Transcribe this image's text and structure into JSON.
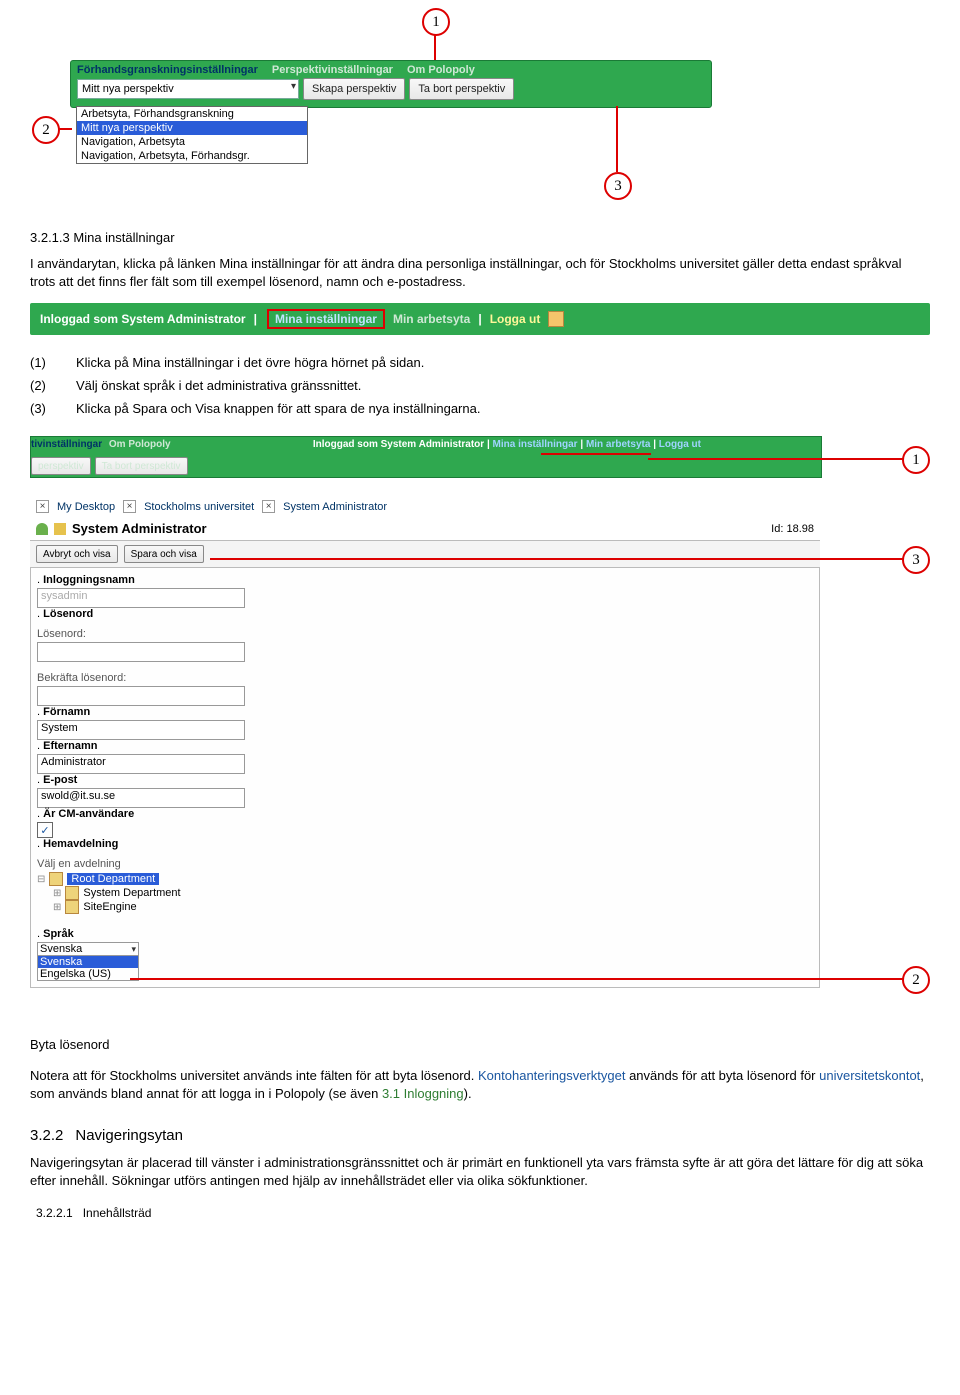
{
  "fig1": {
    "tabs": [
      "Förhandsgranskningsinställningar",
      "Perspektivinställningar",
      "Om Polopoly"
    ],
    "select_current": "Mitt nya perspektiv",
    "btn_create": "Skapa perspektiv",
    "btn_delete": "Ta bort perspektiv",
    "options": [
      "Arbetsyta, Förhandsgranskning",
      "Mitt nya perspektiv",
      "Navigation, Arbetsyta",
      "Navigation, Arbetsyta, Förhandsgr."
    ],
    "callouts": {
      "c1": "1",
      "c2": "2",
      "c3": "3"
    }
  },
  "section1": {
    "num_title": "3.2.1.3 Mina inställningar",
    "para": "I användarytan, klicka på länken Mina inställningar för att ändra dina personliga inställningar, och för Stockholms universitet gäller detta endast språkval trots att det finns fler fält som till exempel lösenord, namn och e-postadress."
  },
  "greenbar": {
    "label": "Inloggad som System Administrator",
    "mina": "Mina inställningar",
    "work": "Min arbetsyta",
    "logout": "Logga ut"
  },
  "numlist": {
    "i1": "Klicka på Mina inställningar i det övre högra hörnet på sidan.",
    "i2": "Välj önskat språk i det administrativa gränssnittet.",
    "i3": "Klicka på Spara och Visa knappen för att spara de nya inställningarna.",
    "n1": "(1)",
    "n2": "(2)",
    "n3": "(3)"
  },
  "fig2": {
    "top_left1": "tivinställningar",
    "top_left2": "Om Polopoly",
    "top_btn1": "perspektiv",
    "top_btn2": "Ta bort perspektiv",
    "top_right_logged": "Inloggad som System Administrator",
    "top_right_mina": "Mina inställningar",
    "top_right_work": "Min arbetsyta",
    "top_right_logout": "Logga ut",
    "crumb1": "My Desktop",
    "crumb2": "Stockholms universitet",
    "crumb3": "System Administrator",
    "title": "System Administrator",
    "id": "Id: 18.98",
    "btn_cancel": "Avbryt och visa",
    "btn_save": "Spara och visa",
    "lbl_login": "Inloggningsnamn",
    "val_login": "sysadmin",
    "lbl_pwd": "Lösenord",
    "lbl_pwd2": "Lösenord:",
    "lbl_confirm": "Bekräfta lösenord:",
    "lbl_first": "Förnamn",
    "val_first": "System",
    "lbl_last": "Efternamn",
    "val_last": "Administrator",
    "lbl_email": "E-post",
    "val_email": "swold@it.su.se",
    "lbl_cm": "Är CM-användare",
    "lbl_dept": "Hemavdelning",
    "lbl_choose": "Välj en avdelning",
    "tree_root": "Root Department",
    "tree_child1": "System Department",
    "tree_child2": "SiteEngine",
    "lbl_lang": "Språk",
    "lang_current": "Svenska",
    "lang_opt1": "Svenska",
    "lang_opt2": "Engelska (US)",
    "callouts": {
      "c1": "1",
      "c2": "2",
      "c3": "3"
    }
  },
  "section2": {
    "byta": "Byta lösenord",
    "p1a": "Notera att för Stockholms universitet används inte fälten för att byta lösenord. ",
    "p1b": "Kontohanteringsverktyget",
    "p1c": " används för att byta lösenord för ",
    "p1d": "universitetskontot",
    "p1e": ", som används bland annat för att logga in i Polopoly (se även ",
    "p1f": "3.1 Inloggning",
    "p1g": ")."
  },
  "section3": {
    "num": "3.2.2",
    "title": "Navigeringsytan",
    "para": "Navigeringsytan är placerad till vänster i administrationsgränssnittet och är primärt en funktionell yta vars främsta syfte är att göra det lättare för dig att söka efter innehåll. Sökningar utförs antingen med hjälp av innehållsträdet eller via olika sökfunktioner."
  },
  "section4": {
    "num": "3.2.2.1",
    "title": "Innehållsträd"
  }
}
